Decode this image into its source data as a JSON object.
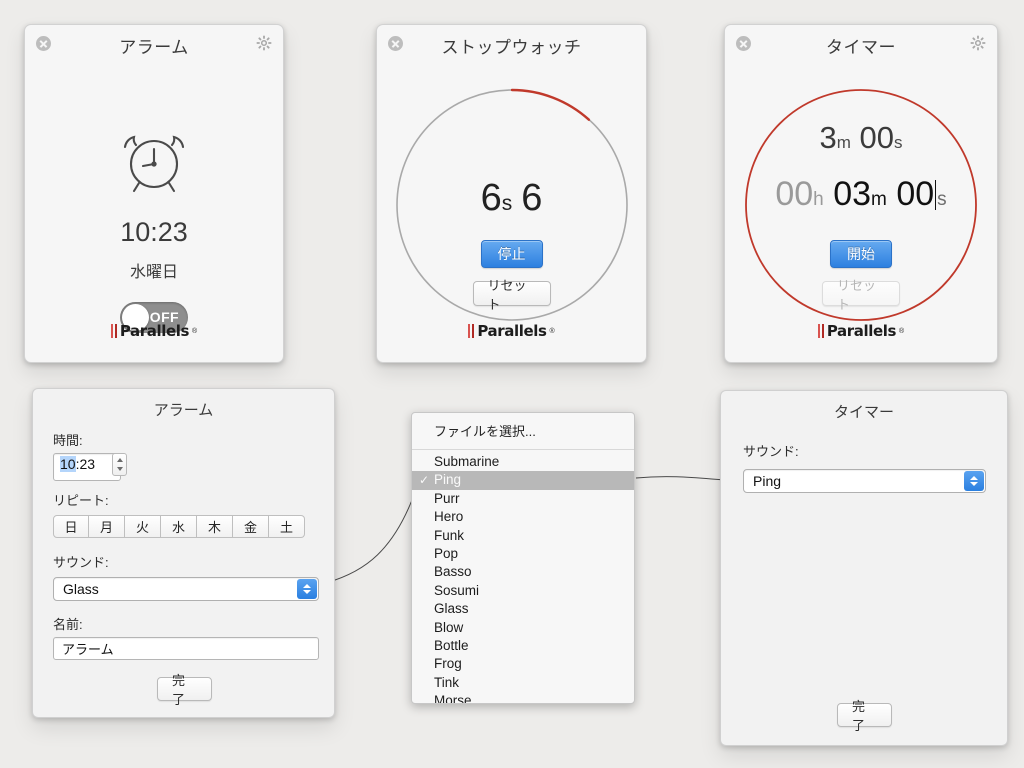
{
  "alarm_widget": {
    "title": "アラーム",
    "icon": "alarm-clock-icon",
    "time": "10:23",
    "day": "水曜日",
    "toggle_label": "OFF",
    "toggle_state": "off",
    "close_icon": "close-icon",
    "gear_icon": "gear-icon",
    "brand": "Parallels",
    "brand_mark": "®"
  },
  "stopwatch_widget": {
    "title": "ストップウォッチ",
    "seconds": "6",
    "seconds_unit": "s",
    "tenths": "6",
    "start_button": "停止",
    "reset_button": "リセット",
    "ring_progress_deg": 42,
    "ring_color": "#c0392b",
    "ring_track_color": "#a9a9a9",
    "brand": "Parallels",
    "brand_mark": "®"
  },
  "timer_widget": {
    "title": "タイマー",
    "display_minutes": "3",
    "display_minutes_unit": "m",
    "display_seconds": "00",
    "display_seconds_unit": "s",
    "edit_hours": "00",
    "edit_hours_unit": "h",
    "edit_minutes": "03",
    "edit_minutes_unit": "m",
    "edit_seconds": "00",
    "edit_seconds_unit": "s",
    "start_button": "開始",
    "reset_button": "リセット",
    "reset_disabled": true,
    "ring_color": "#c0392b",
    "brand": "Parallels",
    "brand_mark": "®"
  },
  "alarm_settings": {
    "title": "アラーム",
    "time_label": "時間:",
    "time_value_selected": "10",
    "time_value_rest": ":23",
    "repeat_label": "リピート:",
    "days": [
      "日",
      "月",
      "火",
      "水",
      "木",
      "金",
      "土"
    ],
    "sound_label": "サウンド:",
    "sound_value": "Glass",
    "name_label": "名前:",
    "name_value": "アラーム",
    "done_button": "完了"
  },
  "timer_settings": {
    "title": "タイマー",
    "sound_label": "サウンド:",
    "sound_value": "Ping",
    "done_button": "完了"
  },
  "sound_menu": {
    "header": "ファイルを選択...",
    "selected": "Ping",
    "check_glyph": "✓",
    "items": [
      "Submarine",
      "Ping",
      "Purr",
      "Hero",
      "Funk",
      "Pop",
      "Basso",
      "Sosumi",
      "Glass",
      "Blow",
      "Bottle",
      "Frog",
      "Tink",
      "Morse"
    ]
  },
  "colors": {
    "background": "#edecea",
    "widget_bg": "#f6f6f6",
    "panel_bg": "#f2f2f2",
    "accent_blue": "#2d80e0",
    "accent_red": "#c0392b",
    "brand_red": "#c0392b"
  }
}
